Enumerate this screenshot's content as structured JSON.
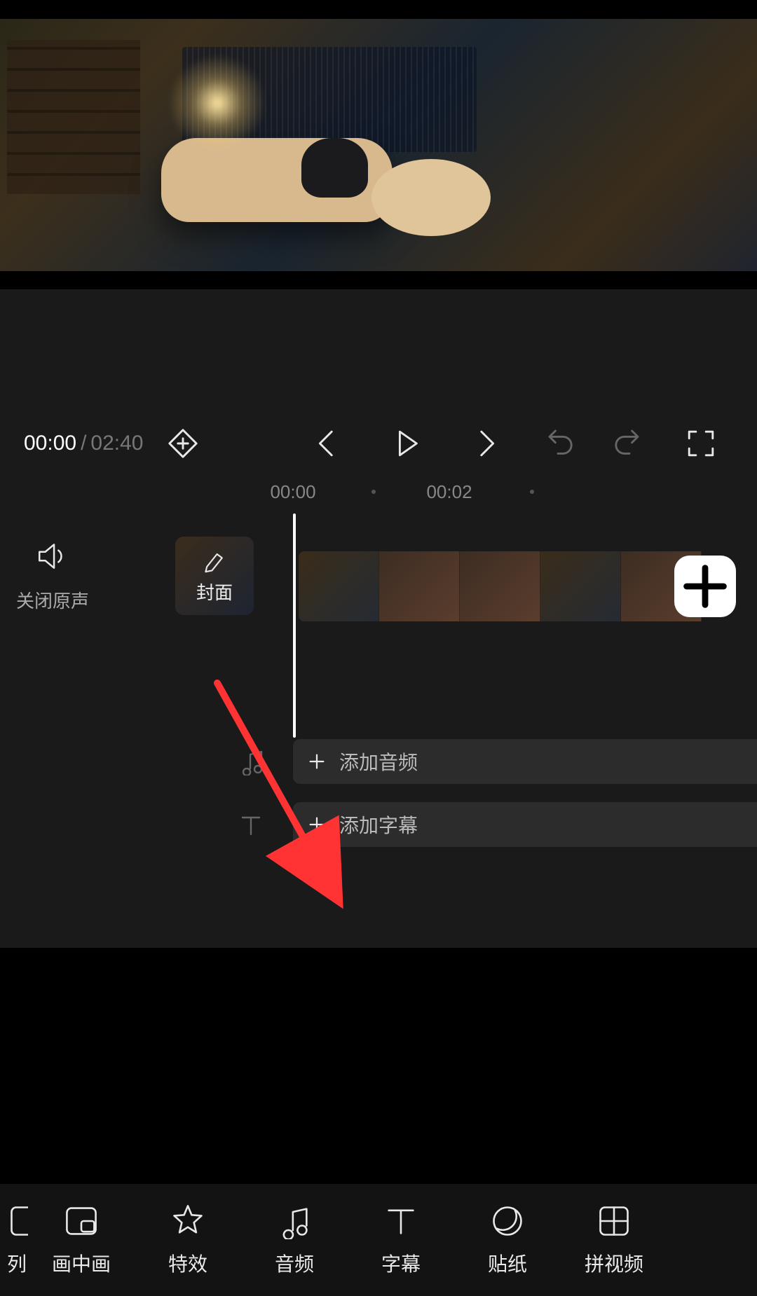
{
  "playback": {
    "current": "00:00",
    "separator": "/",
    "duration": "02:40"
  },
  "ruler": {
    "t0": "00:00",
    "t1": "00:02"
  },
  "timeline": {
    "muteLabel": "关闭原声",
    "coverLabel": "封面",
    "addAudioLabel": "添加音频",
    "addSubtitleLabel": "添加字幕"
  },
  "toolbar": {
    "items": [
      {
        "label": "列"
      },
      {
        "label": "画中画"
      },
      {
        "label": "特效"
      },
      {
        "label": "音频"
      },
      {
        "label": "字幕"
      },
      {
        "label": "贴纸"
      },
      {
        "label": "拼视频"
      }
    ]
  }
}
